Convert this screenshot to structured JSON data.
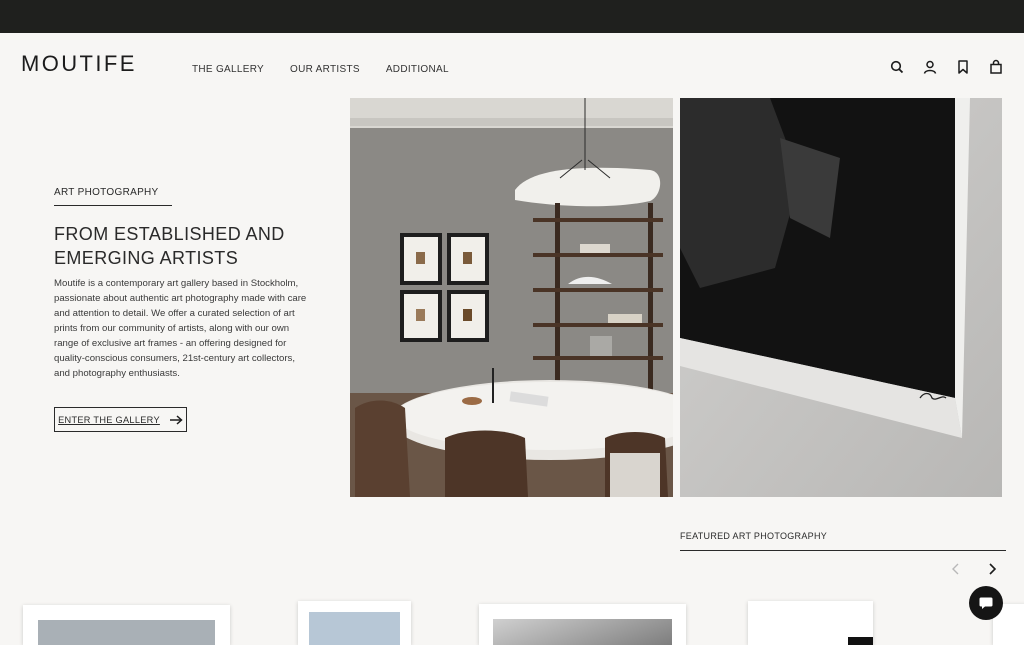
{
  "brand": {
    "logo": "MOUTIFE"
  },
  "nav": {
    "items": [
      "THE GALLERY",
      "OUR ARTISTS",
      "ADDITIONAL"
    ]
  },
  "header_icons": [
    "search-icon",
    "account-icon",
    "bookmark-icon",
    "bag-icon"
  ],
  "intro": {
    "kicker": "ART PHOTOGRAPHY",
    "headline": "FROM ESTABLISHED AND EMERGING ARTISTS",
    "paragraph": "Moutife is a contemporary art gallery based in Stockholm, passionate about authentic art photography made with care and attention to detail. We offer a curated selection of art prints from our community of artists, along with our own range of exclusive art frames - an offering designed for quality-conscious consumers, 21st-century art collectors, and photography enthusiasts.",
    "cta_label": "ENTER THE GALLERY"
  },
  "featured": {
    "title": "FEATURED ART PHOTOGRAPHY"
  },
  "colors": {
    "topbar": "#1f201e",
    "background": "#f7f6f4",
    "text": "#2a2a2a",
    "chat": "#151515"
  }
}
